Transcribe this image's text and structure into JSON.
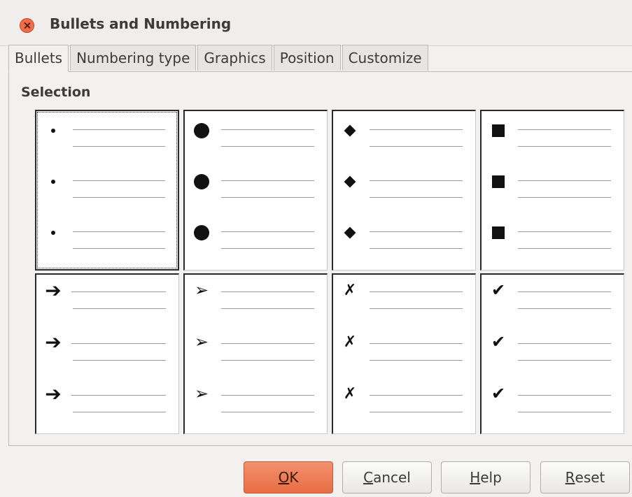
{
  "window": {
    "title": "Bullets and Numbering"
  },
  "tabs": [
    {
      "label": "Bullets",
      "active": true
    },
    {
      "label": "Numbering type",
      "active": false
    },
    {
      "label": "Graphics",
      "active": false
    },
    {
      "label": "Position",
      "active": false
    },
    {
      "label": "Customize",
      "active": false
    }
  ],
  "selection": {
    "label": "Selection"
  },
  "bullet_styles": [
    {
      "icon": "small-dot-bullet-icon",
      "selected": true
    },
    {
      "icon": "large-circle-bullet-icon",
      "selected": false
    },
    {
      "icon": "diamond-bullet-icon",
      "selected": false
    },
    {
      "icon": "square-bullet-icon",
      "selected": false
    },
    {
      "icon": "arrow-bullet-icon",
      "glyph": "➔",
      "selected": false
    },
    {
      "icon": "arrowhead-bullet-icon",
      "glyph": "➢",
      "selected": false
    },
    {
      "icon": "cross-mark-bullet-icon",
      "glyph": "✗",
      "selected": false
    },
    {
      "icon": "check-mark-bullet-icon",
      "glyph": "✔",
      "selected": false
    }
  ],
  "buttons": {
    "ok": {
      "mnemonic": "O",
      "rest": "K"
    },
    "cancel": {
      "mnemonic": "C",
      "rest": "ancel"
    },
    "help": {
      "mnemonic": "H",
      "rest": "elp"
    },
    "reset": {
      "mnemonic": "R",
      "rest": "eset"
    }
  },
  "colors": {
    "accent": "#e86d43",
    "close": "#ef6d4a"
  }
}
